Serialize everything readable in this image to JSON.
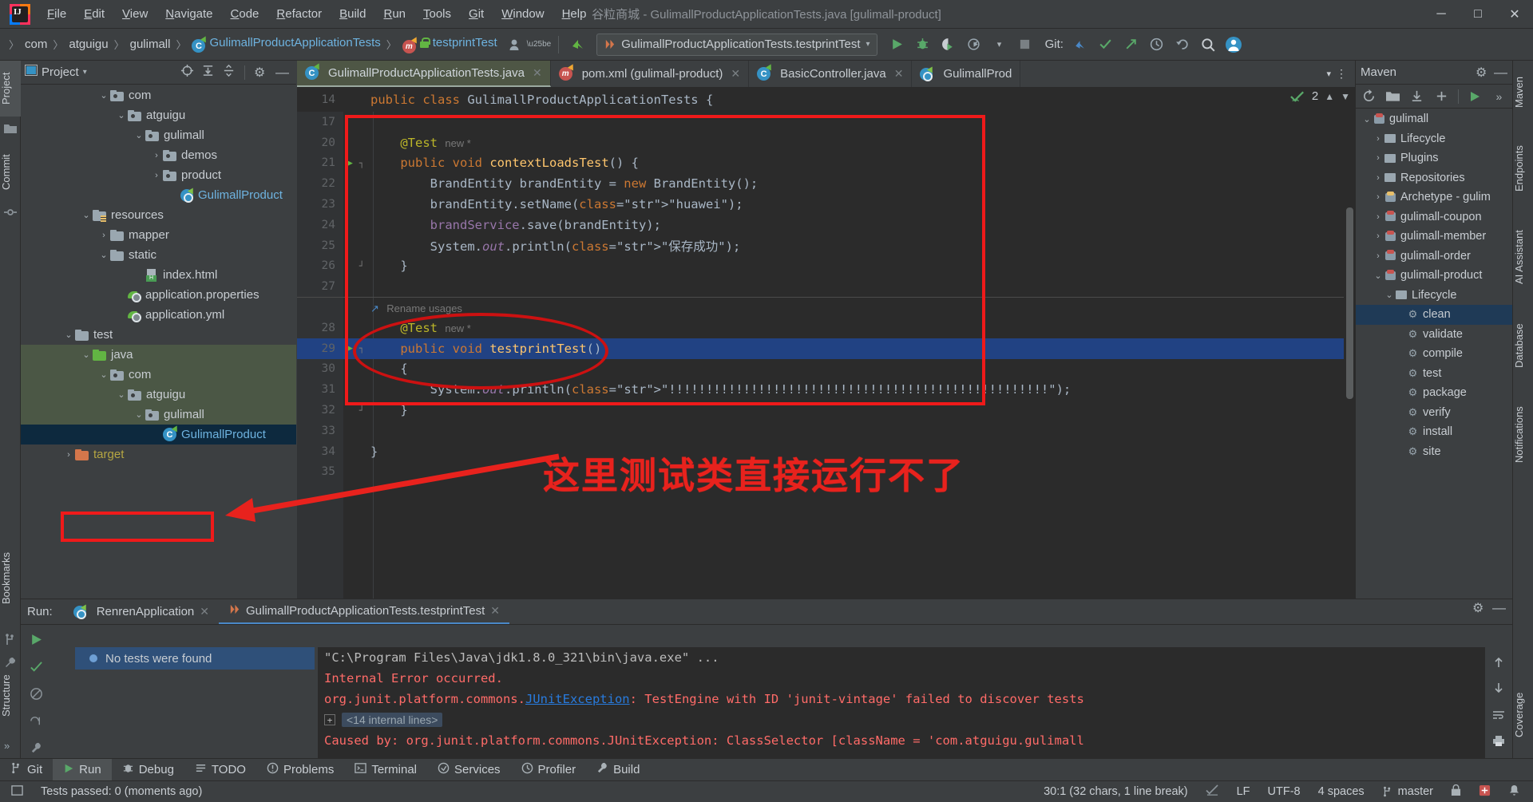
{
  "window": {
    "title": "谷粒商城 - GulimallProductApplicationTests.java [gulimall-product]",
    "minimize": "─",
    "maximize": "□",
    "close": "✕"
  },
  "menu": [
    "File",
    "Edit",
    "View",
    "Navigate",
    "Code",
    "Refactor",
    "Build",
    "Run",
    "Tools",
    "Git",
    "Window",
    "Help"
  ],
  "breadcrumbs": [
    {
      "label": "com",
      "type": "plain"
    },
    {
      "label": "atguigu",
      "type": "plain"
    },
    {
      "label": "gulimall",
      "type": "plain"
    },
    {
      "label": "GulimallProductApplicationTests",
      "type": "class"
    },
    {
      "label": "testprintTest",
      "type": "method"
    }
  ],
  "toolbar": {
    "run_config": "GulimallProductApplicationTests.testprintTest",
    "git_label": "Git:",
    "run_tooltip": "Run",
    "debug_tooltip": "Debug",
    "coverage_tooltip": "Run with Coverage",
    "profile_tooltip": "Profiler",
    "stop_tooltip": "Stop",
    "search_tooltip": "Search Everywhere",
    "account_tooltip": "Account"
  },
  "left_stripe": [
    {
      "label": "Project",
      "active": true
    },
    {
      "label": "Commit",
      "active": false
    },
    {
      "label": "Bookmarks",
      "active": false
    },
    {
      "label": "Structure",
      "active": false
    }
  ],
  "right_stripe": [
    {
      "label": "Maven"
    },
    {
      "label": "Endpoints"
    },
    {
      "label": "AI Assistant"
    },
    {
      "label": "Database"
    },
    {
      "label": "Notifications"
    },
    {
      "label": "Coverage"
    }
  ],
  "project_panel": {
    "title": "Project",
    "tree": [
      {
        "indent": 4,
        "chevron": "⌄",
        "icon": "package",
        "label": "com",
        "style": "plain",
        "row": "normal"
      },
      {
        "indent": 5,
        "chevron": "⌄",
        "icon": "package",
        "label": "atguigu",
        "style": "plain",
        "row": "normal"
      },
      {
        "indent": 6,
        "chevron": "⌄",
        "icon": "package",
        "label": "gulimall",
        "style": "plain",
        "row": "normal"
      },
      {
        "indent": 7,
        "chevron": "›",
        "icon": "package",
        "label": "demos",
        "style": "plain",
        "row": "normal"
      },
      {
        "indent": 7,
        "chevron": "›",
        "icon": "package",
        "label": "product",
        "style": "plain",
        "row": "normal"
      },
      {
        "indent": 8,
        "chevron": "",
        "icon": "spring",
        "label": "GulimallProduct",
        "style": "blue",
        "row": "normal"
      },
      {
        "indent": 3,
        "chevron": "⌄",
        "icon": "resource",
        "label": "resources",
        "style": "plain",
        "row": "normal"
      },
      {
        "indent": 4,
        "chevron": "›",
        "icon": "folder",
        "label": "mapper",
        "style": "plain",
        "row": "normal"
      },
      {
        "indent": 4,
        "chevron": "⌄",
        "icon": "folder",
        "label": "static",
        "style": "plain",
        "row": "normal"
      },
      {
        "indent": 6,
        "chevron": "",
        "icon": "html",
        "label": "index.html",
        "style": "plain",
        "row": "normal"
      },
      {
        "indent": 5,
        "chevron": "",
        "icon": "leaf",
        "label": "application.properties",
        "style": "plain",
        "row": "normal"
      },
      {
        "indent": 5,
        "chevron": "",
        "icon": "leaf",
        "label": "application.yml",
        "style": "plain",
        "row": "normal"
      },
      {
        "indent": 2,
        "chevron": "⌄",
        "icon": "folder",
        "label": "test",
        "style": "plain",
        "row": "normal"
      },
      {
        "indent": 3,
        "chevron": "⌄",
        "icon": "green",
        "label": "java",
        "style": "plain",
        "row": "green"
      },
      {
        "indent": 4,
        "chevron": "⌄",
        "icon": "package",
        "label": "com",
        "style": "plain",
        "row": "green"
      },
      {
        "indent": 5,
        "chevron": "⌄",
        "icon": "package",
        "label": "atguigu",
        "style": "plain",
        "row": "green"
      },
      {
        "indent": 6,
        "chevron": "⌄",
        "icon": "package",
        "label": "gulimall",
        "style": "plain",
        "row": "green"
      },
      {
        "indent": 7,
        "chevron": "",
        "icon": "class",
        "label": "GulimallProduct",
        "style": "blue",
        "row": "sel"
      },
      {
        "indent": 2,
        "chevron": "›",
        "icon": "orange",
        "label": "target",
        "style": "yellow",
        "row": "normal"
      }
    ]
  },
  "editor": {
    "tabs": [
      {
        "label": "GulimallProductApplicationTests.java",
        "icon": "class",
        "active": true,
        "close": "✕"
      },
      {
        "label": "pom.xml (gulimall-product)",
        "icon": "maven",
        "active": false,
        "close": "✕"
      },
      {
        "label": "BasicController.java",
        "icon": "class",
        "active": false,
        "close": "✕"
      },
      {
        "label": "GulimallProd",
        "icon": "spring",
        "active": false,
        "close": ""
      }
    ],
    "sticky_header": "public class GulimallProductApplicationTests {",
    "sticky_header_line": "14",
    "inspection_count": "2",
    "lines": [
      {
        "n": "17",
        "text": "",
        "kind": "blank"
      },
      {
        "n": "20",
        "kind": "anno",
        "text": "    @Test",
        "hint": "new *"
      },
      {
        "n": "21",
        "kind": "sig",
        "text": "    public void contextLoadsTest() {",
        "runmark": true,
        "fold": "┐"
      },
      {
        "n": "22",
        "kind": "code",
        "text": "        BrandEntity brandEntity = new BrandEntity();"
      },
      {
        "n": "23",
        "kind": "code",
        "text": "        brandEntity.setName(\"huawei\");"
      },
      {
        "n": "24",
        "kind": "code",
        "text": "        brandService.save(brandEntity);"
      },
      {
        "n": "25",
        "kind": "code",
        "text": "        System.out.println(\"保存成功\");"
      },
      {
        "n": "26",
        "kind": "code",
        "text": "    }",
        "fold": "┘"
      },
      {
        "n": "27",
        "kind": "blank",
        "text": ""
      },
      {
        "n": "",
        "kind": "inlay",
        "text": "Rename usages"
      },
      {
        "n": "28",
        "kind": "anno",
        "text": "    @Test",
        "hint": "new *"
      },
      {
        "n": "29",
        "kind": "sig",
        "text": "    public void testprintTest()",
        "runmark": true,
        "fold": "┐",
        "selected": true
      },
      {
        "n": "30",
        "kind": "code",
        "text": "    {"
      },
      {
        "n": "31",
        "kind": "code",
        "text": "        System.out.println(\"!!!!!!!!!!!!!!!!!!!!!!!!!!!!!!!!!!!!!!!!!!!!!!!!!!!\");"
      },
      {
        "n": "32",
        "kind": "code",
        "text": "    }",
        "fold": "┘"
      },
      {
        "n": "33",
        "kind": "blank",
        "text": ""
      },
      {
        "n": "34",
        "kind": "code",
        "text": "}"
      },
      {
        "n": "35",
        "kind": "blank",
        "text": ""
      }
    ]
  },
  "maven": {
    "title": "Maven",
    "tree": [
      {
        "indent": 0,
        "chevron": "⌄",
        "icon": "project",
        "label": "gulimall",
        "sel": false
      },
      {
        "indent": 1,
        "chevron": "›",
        "icon": "folder",
        "label": "Lifecycle",
        "sel": false
      },
      {
        "indent": 1,
        "chevron": "›",
        "icon": "folder",
        "label": "Plugins",
        "sel": false
      },
      {
        "indent": 1,
        "chevron": "›",
        "icon": "folder",
        "label": "Repositories",
        "sel": false
      },
      {
        "indent": 1,
        "chevron": "›",
        "icon": "arch",
        "label": "Archetype - gulim",
        "sel": false
      },
      {
        "indent": 1,
        "chevron": "›",
        "icon": "project",
        "label": "gulimall-coupon",
        "sel": false
      },
      {
        "indent": 1,
        "chevron": "›",
        "icon": "project",
        "label": "gulimall-member",
        "sel": false
      },
      {
        "indent": 1,
        "chevron": "›",
        "icon": "project",
        "label": "gulimall-order",
        "sel": false
      },
      {
        "indent": 1,
        "chevron": "⌄",
        "icon": "project",
        "label": "gulimall-product",
        "sel": false
      },
      {
        "indent": 2,
        "chevron": "⌄",
        "icon": "folder",
        "label": "Lifecycle",
        "sel": false
      },
      {
        "indent": 3,
        "chevron": "",
        "icon": "goal",
        "label": "clean",
        "sel": true
      },
      {
        "indent": 3,
        "chevron": "",
        "icon": "goal",
        "label": "validate",
        "sel": false
      },
      {
        "indent": 3,
        "chevron": "",
        "icon": "goal",
        "label": "compile",
        "sel": false
      },
      {
        "indent": 3,
        "chevron": "",
        "icon": "goal",
        "label": "test",
        "sel": false
      },
      {
        "indent": 3,
        "chevron": "",
        "icon": "goal",
        "label": "package",
        "sel": false
      },
      {
        "indent": 3,
        "chevron": "",
        "icon": "goal",
        "label": "verify",
        "sel": false
      },
      {
        "indent": 3,
        "chevron": "",
        "icon": "goal",
        "label": "install",
        "sel": false
      },
      {
        "indent": 3,
        "chevron": "",
        "icon": "goal",
        "label": "site",
        "sel": false
      }
    ]
  },
  "run_panel": {
    "label": "Run:",
    "tabs": [
      {
        "label": "RenrenApplication",
        "icon": "spring",
        "active": false,
        "close": "✕"
      },
      {
        "label": "GulimallProductApplicationTests.testprintTest",
        "icon": "test",
        "active": true,
        "close": "✕"
      }
    ],
    "test_tree_item": "No tests were found",
    "console": [
      {
        "kind": "gray",
        "text": "\"C:\\Program Files\\Java\\jdk1.8.0_321\\bin\\java.exe\" ..."
      },
      {
        "kind": "red",
        "text": "Internal Error occurred."
      },
      {
        "kind": "mixed_link",
        "pre": "org.junit.platform.commons.",
        "link": "JUnitException",
        "post": ": TestEngine with ID 'junit-vintage' failed to discover tests"
      },
      {
        "kind": "fold",
        "text": "<14 internal lines>"
      },
      {
        "kind": "red",
        "text": "Caused by: org.junit.platform.commons.JUnitException: ClassSelector [className = 'com.atguigu.gulimall"
      }
    ]
  },
  "annotation": {
    "callout_text": "这里测试类直接运行不了"
  },
  "bottom_tabs": [
    {
      "label": "Git",
      "icon": "git",
      "active": false
    },
    {
      "label": "Run",
      "icon": "run",
      "active": true
    },
    {
      "label": "Debug",
      "icon": "debug",
      "active": false
    },
    {
      "label": "TODO",
      "icon": "todo",
      "active": false
    },
    {
      "label": "Problems",
      "icon": "problems",
      "active": false
    },
    {
      "label": "Terminal",
      "icon": "terminal",
      "active": false
    },
    {
      "label": "Services",
      "icon": "services",
      "active": false
    },
    {
      "label": "Profiler",
      "icon": "profiler",
      "active": false
    },
    {
      "label": "Build",
      "icon": "build",
      "active": false
    }
  ],
  "status_bar": {
    "message": "Tests passed: 0 (moments ago)",
    "caret": "30:1 (32 chars, 1 line break)",
    "line_sep": "LF",
    "encoding": "UTF-8",
    "indent": "4 spaces",
    "branch": "master"
  },
  "colors": {
    "accent_red": "#ef1a1a",
    "selection_blue": "#214283",
    "green": "#62b543",
    "panel_bg": "#3c3f41",
    "editor_bg": "#2b2b2b"
  }
}
